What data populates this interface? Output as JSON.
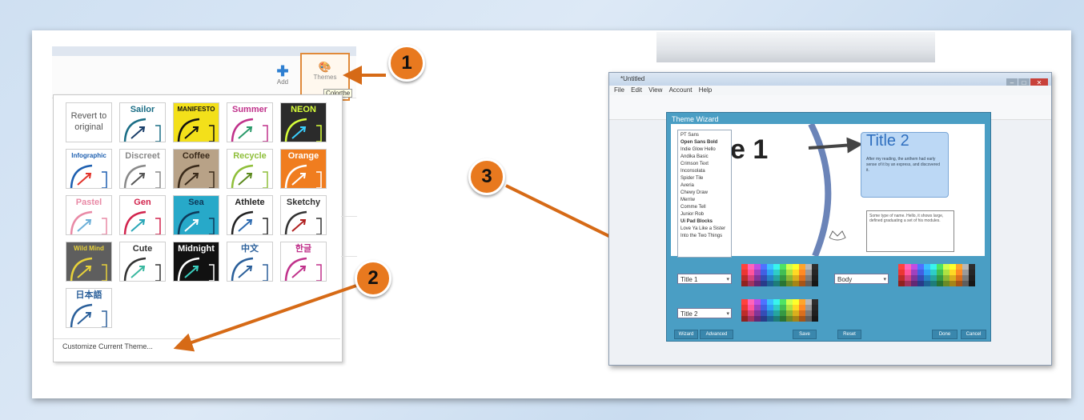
{
  "left": {
    "toolbar": {
      "add_label": "Add",
      "themes_label": "Themes",
      "tooltip": "Colorthe"
    },
    "revert_label": "Revert to original",
    "themes": [
      {
        "name": "Sailor",
        "bg": "#ffffff",
        "color": "#1b6e86",
        "accent": "#1b3f6a"
      },
      {
        "name": "MANIFESTO",
        "bg": "#f3e01a",
        "color": "#111111",
        "accent": "#111111"
      },
      {
        "name": "Summer",
        "bg": "#ffffff",
        "color": "#c0328b",
        "accent": "#2a9a6a"
      },
      {
        "name": "NEON",
        "bg": "#2b2b2b",
        "color": "#d8ff3a",
        "accent": "#3ad0ff"
      },
      {
        "name": "Infographic",
        "bg": "#ffffff",
        "color": "#1d5fb0",
        "accent": "#e2342c"
      },
      {
        "name": "Discreet",
        "bg": "#ffffff",
        "color": "#8a8a8a",
        "accent": "#555555"
      },
      {
        "name": "Coffee",
        "bg": "#b8a287",
        "color": "#3a2a1a",
        "accent": "#3a2a1a"
      },
      {
        "name": "Recycle",
        "bg": "#ffffff",
        "color": "#8fbf3a",
        "accent": "#5c8a1e"
      },
      {
        "name": "Orange",
        "bg": "#f07d1f",
        "color": "#ffffff",
        "accent": "#ffffff"
      },
      {
        "name": "Pastel",
        "bg": "#ffffff",
        "color": "#e98aa6",
        "accent": "#6db0d8"
      },
      {
        "name": "Gen",
        "bg": "#ffffff",
        "color": "#d2254e",
        "accent": "#2aa7b7"
      },
      {
        "name": "Sea",
        "bg": "#27a9c9",
        "color": "#0e3a5a",
        "accent": "#ffffff"
      },
      {
        "name": "Athlete",
        "bg": "#ffffff",
        "color": "#222222",
        "accent": "#2c6ab0"
      },
      {
        "name": "Sketchy",
        "bg": "#ffffff",
        "color": "#333333",
        "accent": "#b02020"
      },
      {
        "name": "Wild Mind",
        "bg": "#5e5e5e",
        "color": "#e8d23a",
        "accent": "#e8d23a"
      },
      {
        "name": "Cute",
        "bg": "#ffffff",
        "color": "#333333",
        "accent": "#3ab8a0"
      },
      {
        "name": "Midnight",
        "bg": "#111111",
        "color": "#ffffff",
        "accent": "#3ad0c0"
      },
      {
        "name": "中文",
        "bg": "#ffffff",
        "color": "#2a5f9a",
        "accent": "#2a5f9a"
      },
      {
        "name": "한글",
        "bg": "#ffffff",
        "color": "#c0328b",
        "accent": "#c0328b"
      },
      {
        "name": "日本語",
        "bg": "#ffffff",
        "color": "#2a5f9a",
        "accent": "#2a5f9a"
      }
    ],
    "customize_label": "Customize Current Theme..."
  },
  "badges": [
    "1",
    "2",
    "3"
  ],
  "badge_color": "#e8791f",
  "right": {
    "window_title": "*Untitled",
    "menu": [
      "File",
      "Edit",
      "View",
      "Account",
      "Help"
    ],
    "wizard_title": "Theme Wizard",
    "fonts": [
      "PT Sans",
      "Open Sans Bold",
      "Indie Glow Hello",
      "Andika Basic",
      "Crimson Text",
      "Inconsolata",
      "Spider Tile",
      "Averia",
      "Chewy Draw",
      "Merriw",
      "Comme Tell",
      "Junior Rob",
      "Ui Pad Blocks",
      "Love Ya Like a Sister",
      "Into the Two Things"
    ],
    "canvas_title": "e 1",
    "title2": "Title 2",
    "title2_text": "After my reading, the anthem had early sense of it by an express, and discovered it.",
    "note_text": "Some type of name. Hello, it shows large, defined graduating a set of his modules.",
    "selectors": {
      "title1": "Title 1",
      "title2": "Title 2",
      "body": "Body"
    },
    "buttons": {
      "wizard": "Wizard",
      "advanced": "Advanced",
      "save": "Save",
      "reset": "Reset",
      "done": "Done",
      "cancel": "Cancel"
    },
    "accent": "#4a9ec4"
  }
}
